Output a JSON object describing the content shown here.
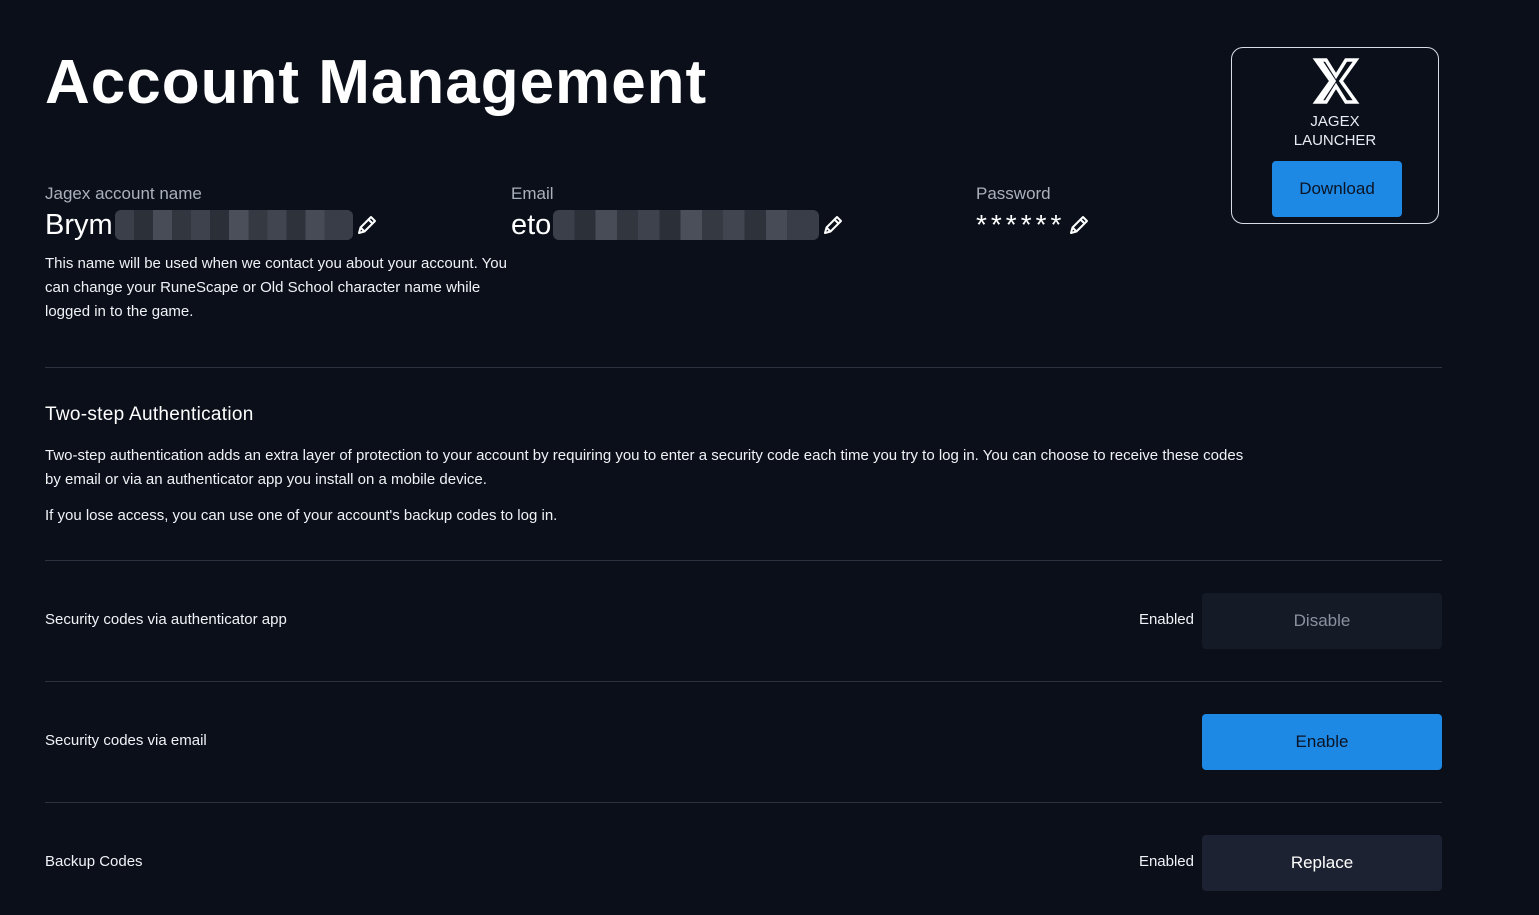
{
  "page": {
    "title": "Account Management"
  },
  "launcher": {
    "logo_icon": "jagex-logo-icon",
    "name_line1": "JAGEX",
    "name_line2": "LAUNCHER",
    "download_label": "Download"
  },
  "account": {
    "name_label": "Jagex account name",
    "name_value": "Brym",
    "email_label": "Email",
    "email_value": "eto",
    "password_label": "Password",
    "password_value": "******",
    "edit_icon": "pencil-icon",
    "note": "This name will be used when we contact you about your account. You can change your RuneScape or Old School character name while logged in to the game."
  },
  "two_step": {
    "title": "Two-step Authentication",
    "description": "Two-step authentication adds an extra layer of protection to your account by requiring you to enter a security code each time you try to log in. You can choose to receive these codes by email or via an authenticator app you install on a mobile device.",
    "backup_note": "If you lose access, you can use one of your account's backup codes to log in.",
    "rows": [
      {
        "label": "Security codes via authenticator app",
        "status": "Enabled",
        "button": "Disable"
      },
      {
        "label": "Security codes via email",
        "status": "",
        "button": "Enable"
      },
      {
        "label": "Backup Codes",
        "status": "Enabled",
        "button": "Replace"
      }
    ]
  },
  "colors": {
    "background": "#0a0f1a",
    "accent": "#1e88e5",
    "button_dark": "#1c2231",
    "divider": "#2c3240"
  }
}
